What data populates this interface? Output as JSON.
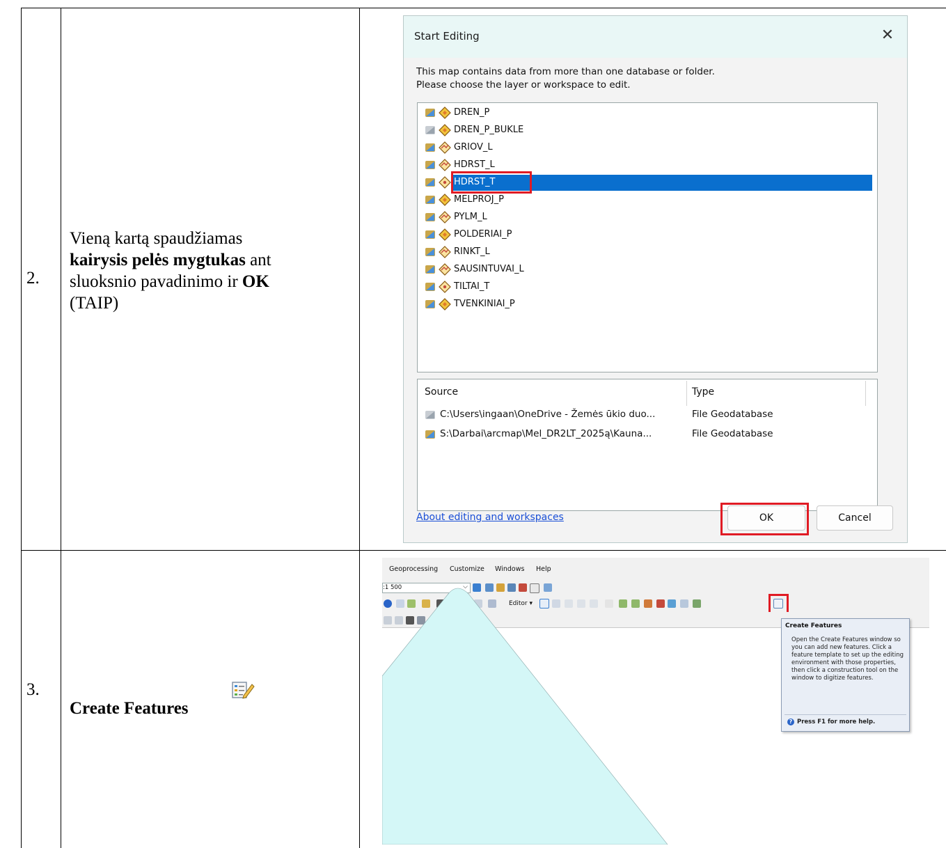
{
  "table": {
    "rows": [
      {
        "number": "2.",
        "description_parts": [
          "Vieną kartą spaudžiamas",
          "kairysis pelės mygtukas",
          "ant",
          "sluoksnio pavadinimo ir",
          "OK",
          "(TAIP)"
        ]
      },
      {
        "number": "3.",
        "description": "Create Features",
        "icon": "create-features-icon"
      }
    ]
  },
  "dialog": {
    "title": "Start Editing",
    "message_line1": "This map contains data from more than one database or folder.",
    "message_line2": "Please choose the layer or workspace to edit.",
    "layers": [
      {
        "name": "DREN_P",
        "db": "blue",
        "type": "polygon"
      },
      {
        "name": "DREN_P_BUKLE",
        "db": "gray",
        "type": "polygon"
      },
      {
        "name": "GRIOV_L",
        "db": "blue",
        "type": "line"
      },
      {
        "name": "HDRST_L",
        "db": "blue",
        "type": "line"
      },
      {
        "name": "HDRST_T",
        "db": "blue",
        "type": "point",
        "selected": true
      },
      {
        "name": "MELPROJ_P",
        "db": "blue",
        "type": "polygon"
      },
      {
        "name": "PYLM_L",
        "db": "blue",
        "type": "line"
      },
      {
        "name": "POLDERIAI_P",
        "db": "blue",
        "type": "polygon"
      },
      {
        "name": "RINKT_L",
        "db": "blue",
        "type": "line"
      },
      {
        "name": "SAUSINTUVAI_L",
        "db": "blue",
        "type": "line"
      },
      {
        "name": "TILTAI_T",
        "db": "blue",
        "type": "point"
      },
      {
        "name": "TVENKINIAI_P",
        "db": "blue",
        "type": "polygon"
      }
    ],
    "source_header": "Source",
    "type_header": "Type",
    "sources": [
      {
        "path": "C:\\Users\\ingaan\\OneDrive - Žemės ūkio duo...",
        "type": "File Geodatabase",
        "db": "gray"
      },
      {
        "path": "S:\\Darbai\\arcmap\\Mel_DR2LT_2025ą\\Kauna...",
        "type": "File Geodatabase",
        "db": "blue"
      }
    ],
    "link": "About editing and workspaces",
    "ok": "OK",
    "cancel": "Cancel",
    "close_icon": "close-icon"
  },
  "arcmap": {
    "menu": [
      "Geoprocessing",
      "Customize",
      "Windows",
      "Help"
    ],
    "scale": ":1 500",
    "editor_label": "Editor",
    "tooltip": {
      "title": "Create Features",
      "body": "Open the Create Features window so you can add new features. Click a feature template to set up the editing environment with those properties, then click a construction tool on the window to digitize features.",
      "help": "Press F1 for more help."
    },
    "map_fill": "#d4f7f7"
  },
  "colors": {
    "highlight": "#0a6fce",
    "red_box": "#e01b24",
    "title_bar": "#e9f7f6"
  }
}
